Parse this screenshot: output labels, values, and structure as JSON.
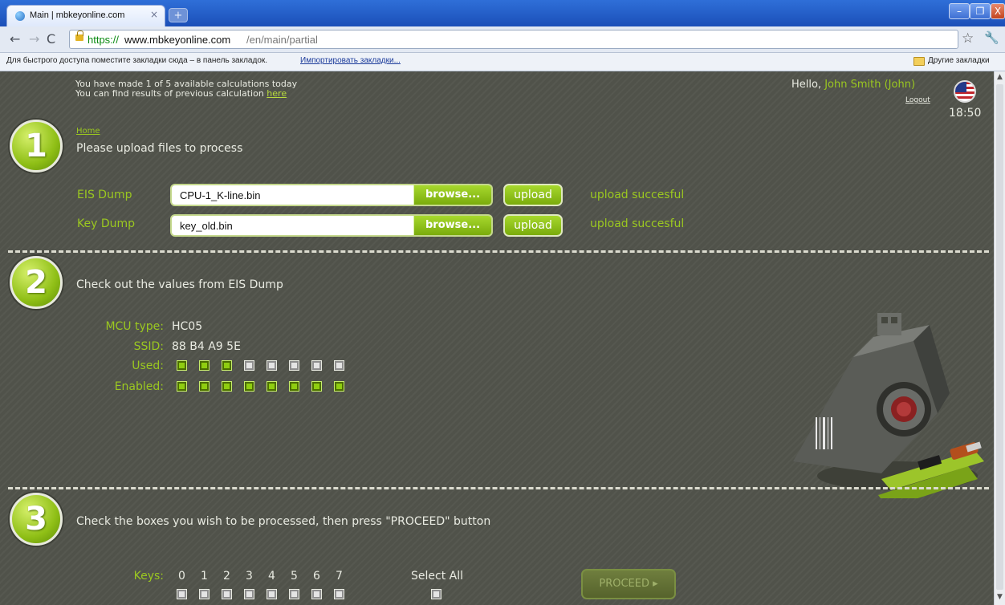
{
  "browser": {
    "tab_title": "Main | mbkeyonline.com",
    "tab_close": "×",
    "new_tab": "+",
    "window_buttons": {
      "minimize": "–",
      "maximize": "❐",
      "close": "X"
    },
    "nav": {
      "back": "←",
      "forward": "→",
      "reload": "C"
    },
    "url": {
      "scheme": "https://",
      "domain": "www.mbkeyonline.com",
      "path": "/en/main/partial"
    },
    "star": "☆",
    "wrench": "🔧",
    "bookmarks_prompt": "Для быстрого доступа поместите закладки сюда – в панель закладок.",
    "bookmarks_import": "Импортировать закладки...",
    "other_bookmarks": "Другие закладки"
  },
  "header": {
    "calc_line1": "You have made 1 of 5 available calculations today",
    "calc_line2_prefix": "You can find results of previous calculation ",
    "calc_line2_link": "here",
    "hello_prefix": "Hello, ",
    "user_name": "John Smith (John)",
    "logout": "Logout",
    "time": "18:50"
  },
  "step1": {
    "number": "1",
    "breadcrumb": "Home",
    "heading": "Please upload files to process",
    "files": [
      {
        "label": "EIS Dump",
        "value": "CPU-1_K-line.bin",
        "browse": "browse...",
        "upload": "upload",
        "status": "upload succesful"
      },
      {
        "label": "Key Dump",
        "value": "key_old.bin",
        "browse": "browse...",
        "upload": "upload",
        "status": "upload succesful"
      }
    ]
  },
  "step2": {
    "number": "2",
    "heading": "Check out the values from EIS Dump",
    "mcu_label": "MCU type:",
    "mcu_value": "HC05",
    "ssid_label": "SSID:",
    "ssid_value": "88 B4 A9 5E",
    "used_label": "Used:",
    "used": [
      true,
      true,
      true,
      false,
      false,
      false,
      false,
      false
    ],
    "enabled_label": "Enabled:",
    "enabled": [
      true,
      true,
      true,
      true,
      true,
      true,
      true,
      true
    ]
  },
  "step3": {
    "number": "3",
    "heading": "Check the boxes you wish to be processed, then press \"PROCEED\" button",
    "keys_label": "Keys:",
    "keys": [
      "0",
      "1",
      "2",
      "3",
      "4",
      "5",
      "6",
      "7"
    ],
    "keys_checked": [
      false,
      false,
      false,
      false,
      false,
      false,
      false,
      false
    ],
    "select_all": "Select All",
    "select_all_checked": false,
    "proceed": "PROCEED ▸"
  },
  "colors": {
    "accent_green": "#9bc820",
    "page_bg": "#50524a",
    "checked_box": "#8fcd10"
  },
  "icons": [
    "favicon-icon",
    "lock-icon",
    "star-icon",
    "wrench-icon",
    "folder-icon",
    "us-flag-icon",
    "ecu-device-illustration"
  ]
}
